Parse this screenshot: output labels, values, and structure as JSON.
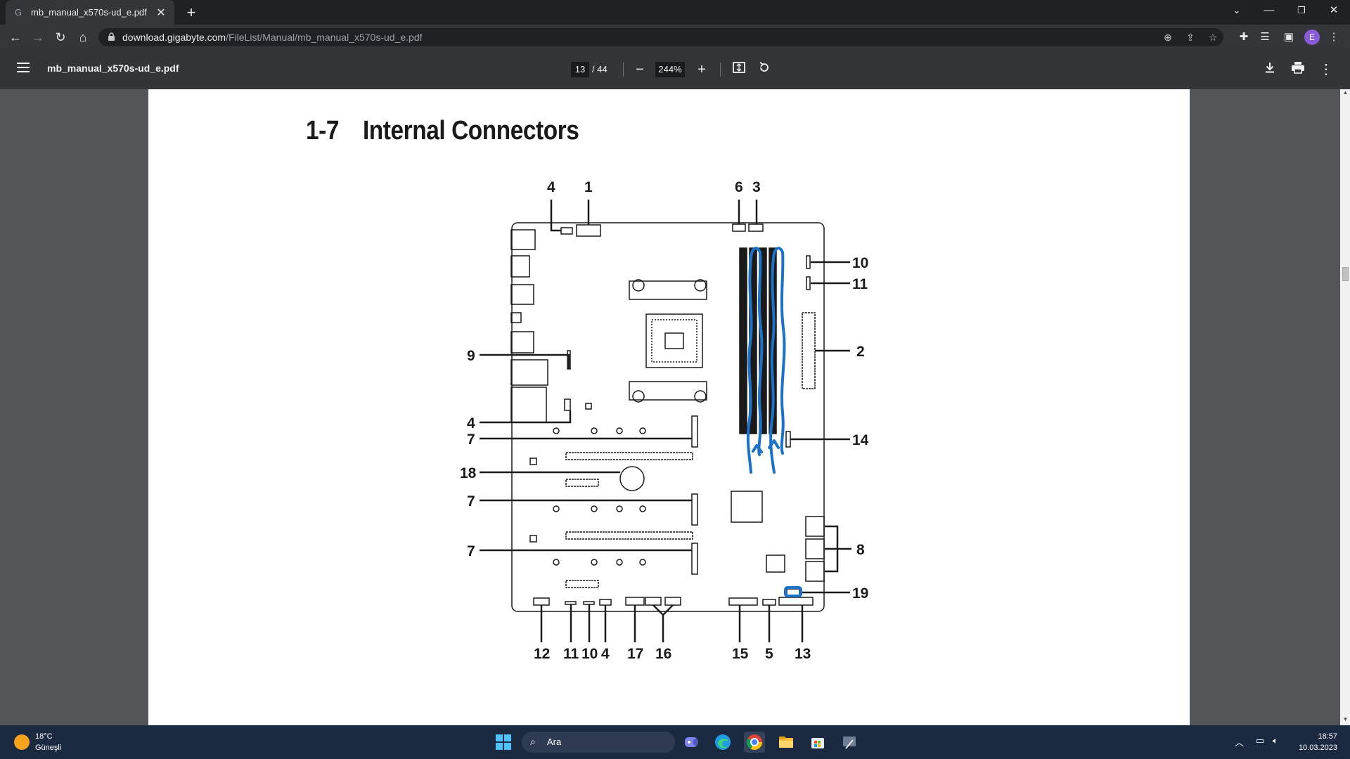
{
  "browser": {
    "tab_title": "mb_manual_x570s-ud_e.pdf",
    "tab_close": "✕",
    "new_tab": "+",
    "url_host": "download.gigabyte.com",
    "url_path": "/FileList/Manual/mb_manual_x570s-ud_e.pdf",
    "profile_initial": "E"
  },
  "pdf_toolbar": {
    "file_name": "mb_manual_x570s-ud_e.pdf",
    "current_page": "13",
    "page_total": "/ 44",
    "zoom": "244%",
    "zoom_out": "−",
    "zoom_in": "+"
  },
  "document": {
    "section_number": "1-7",
    "section_title": "Internal Connectors",
    "callouts": {
      "top_left_a": "4",
      "top_left_b": "1",
      "top_right_a": "6",
      "top_right_b": "3",
      "right_10": "10",
      "right_11": "11",
      "right_2": "2",
      "right_14": "14",
      "right_8": "8",
      "right_19": "19",
      "left_9": "9",
      "left_4": "4",
      "left_7a": "7",
      "left_18": "18",
      "left_7b": "7",
      "left_7c": "7",
      "bottom_12": "12",
      "bottom_11": "11",
      "bottom_10": "10",
      "bottom_4": "4",
      "bottom_17": "17",
      "bottom_16": "16",
      "bottom_15": "15",
      "bottom_5": "5",
      "bottom_13": "13"
    }
  },
  "taskbar": {
    "temperature": "18°C",
    "weather": "Güneşli",
    "search_label": "Ara",
    "time": "18:57",
    "date": "10.03.2023"
  },
  "colors": {
    "annotation_blue": "#1a73c9",
    "taskbar": "#1c2a41",
    "pdf_toolbar": "#323639"
  }
}
